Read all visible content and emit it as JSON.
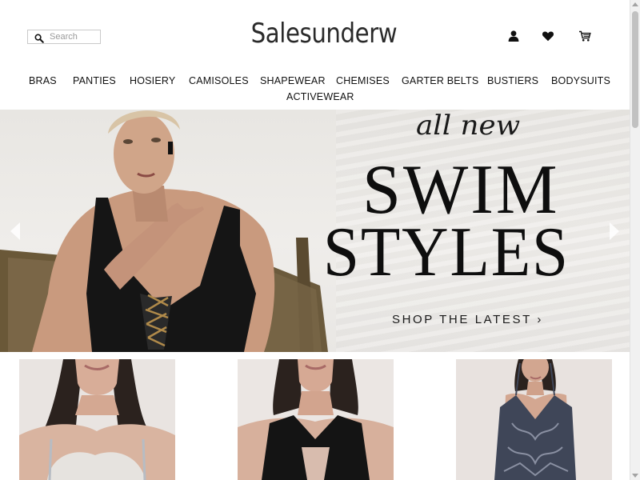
{
  "header": {
    "search_placeholder": "Search",
    "logo": "Salesunderw",
    "icons": [
      "user-icon",
      "heart-icon",
      "cart-icon"
    ]
  },
  "nav": {
    "items": [
      "BRAS",
      "PANTIES",
      "HOSIERY",
      "CAMISOLES",
      "SHAPEWEAR",
      "CHEMISES",
      "GARTER BELTS",
      "BUSTIERS",
      "BODYSUITS",
      "ACTIVEWEAR"
    ]
  },
  "hero": {
    "tagline": "all new",
    "headline_line1": "SWIM",
    "headline_line2": "STYLES",
    "cta": "SHOP THE LATEST ›"
  },
  "products": [
    {
      "image": "model-white-bra"
    },
    {
      "image": "model-black-sports-bra"
    },
    {
      "image": "model-lace-chemise"
    }
  ],
  "colors": {
    "text": "#111111",
    "hero_bg": "#ebe9e6",
    "swimsuit": "#151515",
    "accent_gold": "#b08a4a"
  }
}
